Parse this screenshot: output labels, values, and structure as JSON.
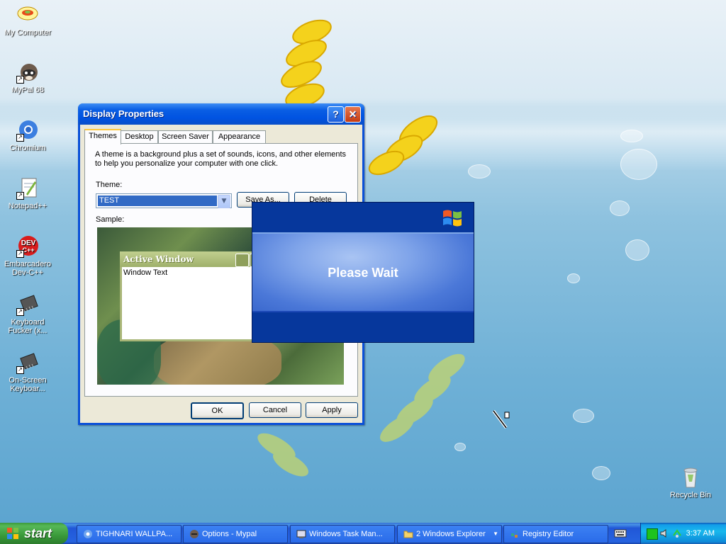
{
  "desktop": {
    "icons": [
      {
        "label": "My Computer"
      },
      {
        "label": "MyPal 68"
      },
      {
        "label": "Chromium"
      },
      {
        "label": "Notepad++"
      },
      {
        "label": "Embarcadero Dev-C++"
      },
      {
        "label": "Keyboard Fucker (x..."
      },
      {
        "label": "On-Screen Keyboar..."
      },
      {
        "label": "Recycle Bin"
      }
    ]
  },
  "dialog": {
    "title": "Display Properties",
    "tabs": [
      "Themes",
      "Desktop",
      "Screen Saver",
      "Appearance"
    ],
    "description": "A theme is a background plus a set of sounds, icons, and other elements to help you personalize your computer with one click.",
    "theme_label": "Theme:",
    "theme_value": "TEST",
    "save_as_label": "Save As...",
    "delete_label": "Delete",
    "sample_label": "Sample:",
    "preview": {
      "window_title": "Active Window",
      "window_text": "Window Text"
    },
    "ok_label": "OK",
    "cancel_label": "Cancel",
    "apply_label": "Apply"
  },
  "wait_dialog": {
    "message": "Please Wait"
  },
  "taskbar": {
    "start_label": "start",
    "tasks": [
      {
        "label": "TIGHNARI WALLPA..."
      },
      {
        "label": "Options - Mypal"
      },
      {
        "label": "Windows Task Man..."
      },
      {
        "label": "2 Windows Explorer"
      },
      {
        "label": "Registry Editor"
      }
    ],
    "clock": "3:37 AM"
  }
}
